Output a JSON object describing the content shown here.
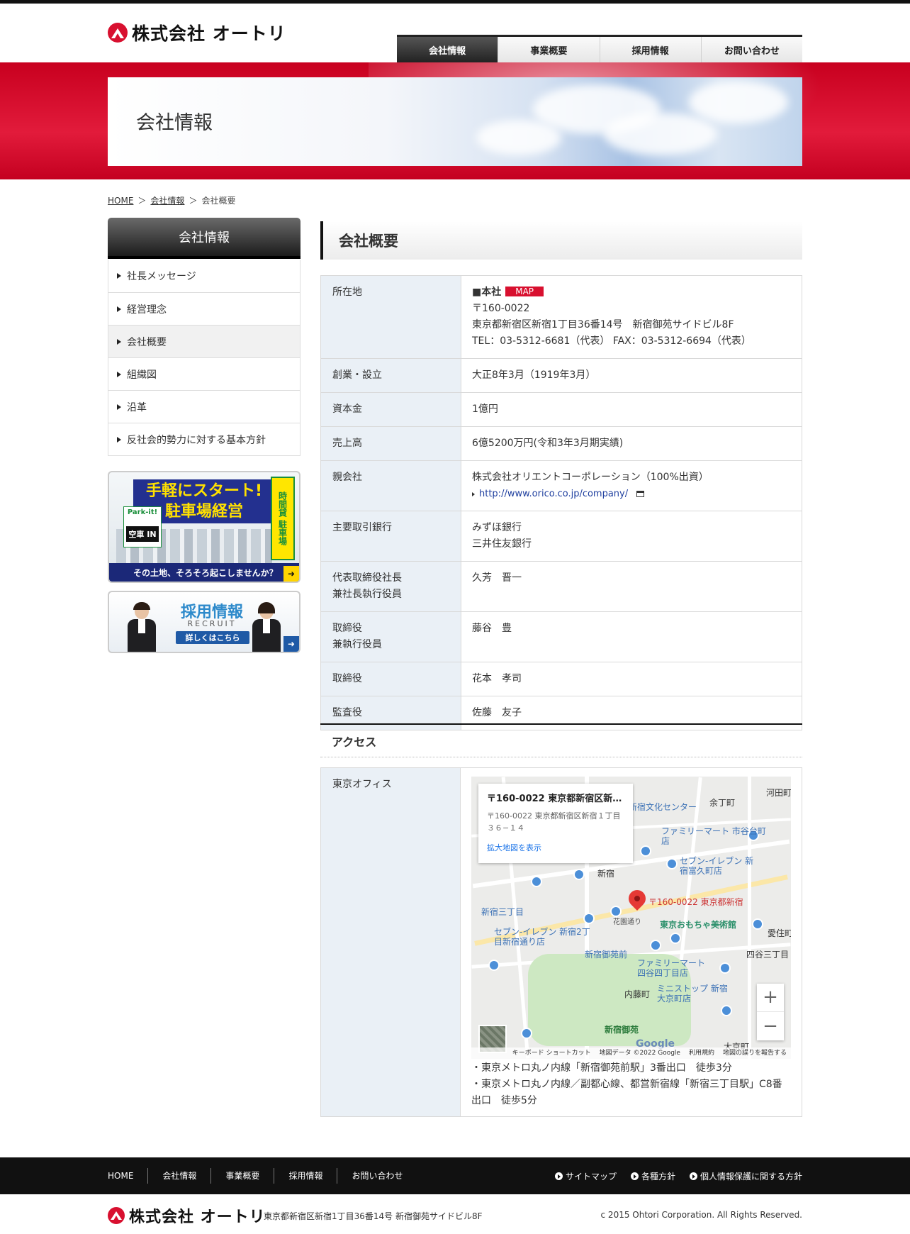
{
  "header": {
    "logo_text": "株式会社 オートリ",
    "nav": [
      "会社情報",
      "事業概要",
      "採用情報",
      "お問い合わせ"
    ]
  },
  "hero": {
    "title": "会社情報"
  },
  "breadcrumb": {
    "home": "HOME",
    "sep": "＞",
    "parent": "会社情報",
    "current": "会社概要"
  },
  "sidebar": {
    "title": "会社情報",
    "items": [
      "社長メッセージ",
      "経営理念",
      "会社概要",
      "組織図",
      "沿革",
      "反社会的勢力に対する基本方針"
    ],
    "active_index": 2
  },
  "banners": {
    "park": {
      "headline1": "手軽にスタート!",
      "headline2": "駐車場経営",
      "side": "時間貸 駐車場",
      "logo": "Park-it!",
      "logo_in": "空車 IN",
      "bottom": "その土地、そろそろ起こしませんか？"
    },
    "recruit": {
      "title": "採用情報",
      "sub": "RECRUIT",
      "button": "詳しくはこちら"
    }
  },
  "main": {
    "title": "会社概要",
    "rows": [
      {
        "label": "所在地",
        "head": "■本社",
        "badge": "MAP",
        "lines": [
          "〒160-0022",
          "東京都新宿区新宿1丁目36番14号　新宿御苑サイドビル8F",
          "TEL：03-5312-6681（代表） FAX：03-5312-6694（代表）"
        ]
      },
      {
        "label": "創業・設立",
        "value": "大正8年3月（1919年3月）"
      },
      {
        "label": "資本金",
        "value": "1億円"
      },
      {
        "label": "売上高",
        "value": "6億5200万円(令和3年3月期実績)"
      },
      {
        "label": "親会社",
        "value": "株式会社オリエントコーポレーション（100%出資）",
        "link": "http://www.orico.co.jp/company/"
      },
      {
        "label": "主要取引銀行",
        "lines": [
          "みずほ銀行",
          "三井住友銀行"
        ]
      },
      {
        "label_lines": [
          "代表取締役社長",
          "兼社長執行役員"
        ],
        "value": "久芳　晋一"
      },
      {
        "label_lines": [
          "取締役",
          "兼執行役員"
        ],
        "value": "藤谷　豊"
      },
      {
        "label": "取締役",
        "value": "花本　孝司"
      },
      {
        "label": "監査役",
        "value": "佐藤　友子"
      }
    ]
  },
  "access": {
    "title": "アクセス",
    "office": "東京オフィス",
    "map": {
      "card_title": "〒160-0022 東京都新宿区新宿…",
      "card_address": "〒160-0022 東京都新宿区新宿１丁目３６−１４",
      "card_link": "拡大地図を表示",
      "pin_label": "〒160-0022 東京都新宿",
      "labels": [
        "新宿文化センター",
        "余丁町",
        "河田町",
        "ファミリーマート 市谷台町店",
        "セブン-イレブン 新宿富久町店",
        "新宿",
        "新宿三丁目",
        "セブン-イレブン 新宿2丁目新宿通り店",
        "東京おもちゃ美術館",
        "新宿御苑前",
        "ファミリーマート 四谷四丁目店",
        "四谷三丁目",
        "内藤町",
        "ミニストップ 新宿大京町店",
        "新宿御苑",
        "大京町",
        "花園通り",
        "愛住町"
      ],
      "google": "Google",
      "footer": [
        "キーボード ショートカット",
        "地図データ ©2022 Google",
        "利用規約",
        "地図の誤りを報告する"
      ],
      "zoom_in": "+",
      "zoom_out": "−"
    },
    "lines": [
      "・東京メトロ丸ノ内線「新宿御苑前駅」3番出口　徒歩3分",
      "・東京メトロ丸ノ内線／副都心線、都営新宿線「新宿三丁目駅」C8番出口　徒歩5分"
    ]
  },
  "footer": {
    "nav": [
      "HOME",
      "会社情報",
      "事業概要",
      "採用情報",
      "お問い合わせ"
    ],
    "sub": [
      "サイトマップ",
      "各種方針",
      "個人情報保護に関する方針"
    ],
    "logo_text": "株式会社 オートリ",
    "address": "東京都新宿区新宿1丁目36番14号 新宿御苑サイドビル8F",
    "copyright": "c 2015 Ohtori Corporation. All Rights Reserved."
  },
  "colors": {
    "brand_red": "#d8102f",
    "nav_dark": "#222222",
    "th_bg": "#eaf0f6"
  }
}
